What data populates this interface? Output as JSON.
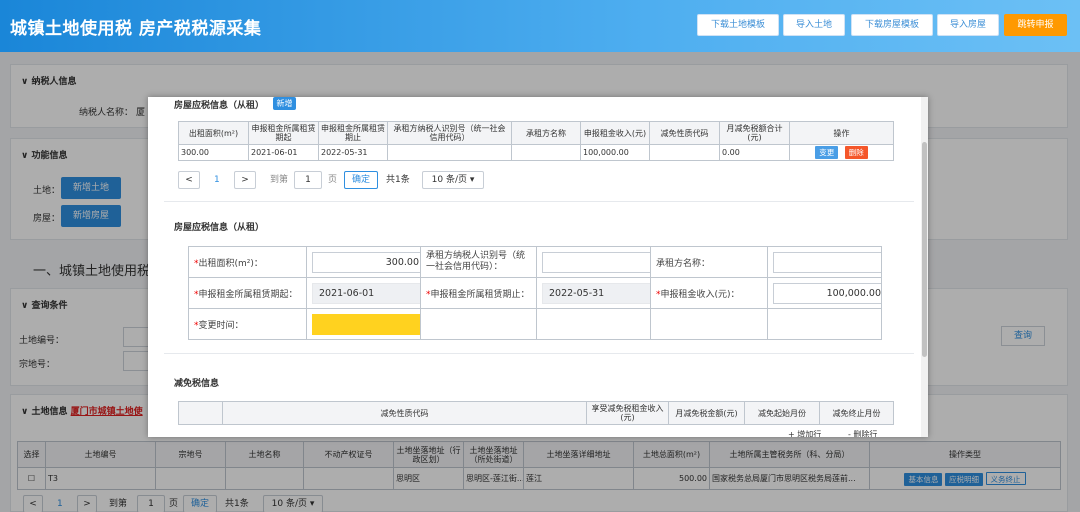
{
  "header": {
    "title": "城镇土地使用税 房产税税源采集",
    "buttons": [
      "下载土地模板",
      "导入土地",
      "下载房屋模板",
      "导入房屋",
      "跳转申报"
    ]
  },
  "background": {
    "taxpayer_section": "纳税人信息",
    "taxpayer_label": "纳税人名称：",
    "taxpayer_value": "厦",
    "function_section": "功能信息",
    "land_label": "土地：",
    "add_land_btn": "新增土地",
    "house_label": "房屋：",
    "add_house_btn": "新增房屋",
    "section_heading": "一、城镇土地使用税",
    "query_section": "查询条件",
    "land_no_label": "土地编号：",
    "parcel_label": "宗地号：",
    "query_btn": "查询",
    "land_info_section": "土地信息",
    "land_info_link": "厦门市城镇土地使",
    "table_headers": [
      "选择",
      "土地编号",
      "宗地号",
      "土地名称",
      "不动产权证号",
      "土地坐落地址（行政区划）",
      "土地坐落地址（所处街道）",
      "土地坐落详细地址",
      "土地总面积(m²)",
      "土地所属主管税务所（科、分局）",
      "操作类型"
    ],
    "table_row": {
      "land_no": "T3",
      "district": "思明区",
      "street": "思明区-莲江街...",
      "address": "莲江",
      "area": "500.00",
      "office": "国家税务总局厦门市思明区税务局莲前...",
      "ops": [
        "基本信息",
        "应税明细",
        "义务终止"
      ]
    },
    "pagination": {
      "prev": "<",
      "page": "1",
      "next": ">",
      "goto": "到第",
      "page_input": "1",
      "page_unit": "页",
      "confirm": "确定",
      "total": "共1条",
      "per_page": "10 条/页"
    }
  },
  "modal": {
    "sublease_title": "房屋应税信息（从租）",
    "add_btn": "新增",
    "grid_headers": [
      "出租面积(m²)",
      "申报租金所属租赁期起",
      "申报租金所属租赁期止",
      "承租方纳税人识别号（统一社会信用代码）",
      "承租方名称",
      "申报租金收入(元)",
      "减免性质代码",
      "月减免税额合计(元)",
      "操作"
    ],
    "grid_row": {
      "area": "300.00",
      "start": "2021-06-01",
      "end": "2022-05-31",
      "tin": "",
      "name": "",
      "income": "100,000.00",
      "code": "",
      "monthly": "0.00",
      "btn_change": "变更",
      "btn_delete": "删除"
    },
    "pagination": {
      "prev": "<",
      "page": "1",
      "next": ">",
      "goto": "到第",
      "page_input": "1",
      "page_unit": "页",
      "confirm": "确定",
      "total": "共1条",
      "per_page": "10 条/页"
    },
    "form_title": "房屋应税信息（从租）",
    "form": {
      "area_label": "出租面积(m²)：",
      "area_value": "300.00",
      "tin_label": "承租方纳税人识别号（统一社会信用代码）：",
      "tin_value": "",
      "name_label": "承租方名称：",
      "name_value": "",
      "start_label": "申报租金所属租赁期起：",
      "start_value": "2021-06-01",
      "end_label": "申报租金所属租赁期止：",
      "end_value": "2022-05-31",
      "income_label": "申报租金收入(元)：",
      "income_value": "100,000.00",
      "change_label": "变更时间：",
      "change_value": ""
    },
    "relief_title": "减免税信息",
    "relief_headers": [
      "减免性质代码",
      "享受减免税租金收入(元)",
      "月减免税金额(元)",
      "减免起始月份",
      "减免终止月份"
    ],
    "relief_partial": [
      "+ 增加行",
      "- 删除行"
    ]
  },
  "colors": {
    "accent": "#2f8fe0",
    "orange": "#ff9900",
    "delete": "#f5572a",
    "highlight": "#ffd21f"
  }
}
